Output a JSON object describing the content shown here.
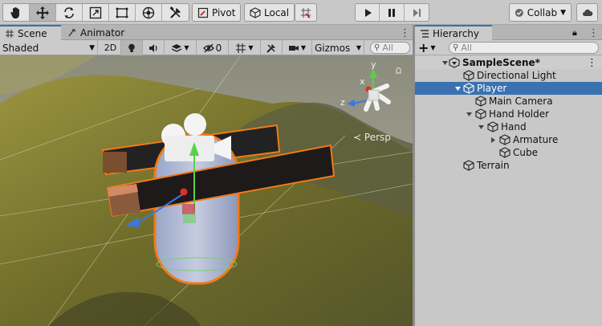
{
  "toolbar": {
    "pivot_label": "Pivot",
    "local_label": "Local",
    "collab_label": "Collab"
  },
  "scene_panel": {
    "tab_scene": "Scene",
    "tab_animator": "Animator",
    "shading_mode": "Shaded",
    "mode_2d": "2D",
    "hidden_count": "0",
    "gizmos_label": "Gizmos",
    "search_placeholder": "All",
    "persp_label": "Persp",
    "axis_x": "x",
    "axis_y": "y",
    "axis_z": "z"
  },
  "hierarchy": {
    "tab_label": "Hierarchy",
    "add_label": "+",
    "search_placeholder": "All",
    "scene_name": "SampleScene*",
    "items": [
      {
        "label": "Directional Light"
      },
      {
        "label": "Player"
      },
      {
        "label": "Main Camera"
      },
      {
        "label": "Hand Holder"
      },
      {
        "label": "Hand"
      },
      {
        "label": "Armature"
      },
      {
        "label": "Cube"
      },
      {
        "label": "Terrain"
      }
    ]
  },
  "colors": {
    "selection": "#3a72b0",
    "highlight_outline": "#f07a1a",
    "terrain": "#8a8a3a"
  }
}
